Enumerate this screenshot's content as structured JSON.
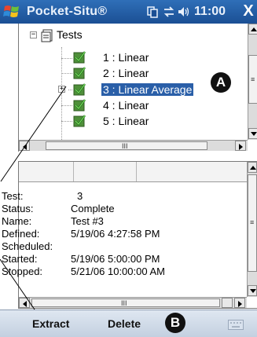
{
  "title_bar": {
    "app_title": "Pocket-Situ®",
    "clock": "11:00",
    "close_glyph": "X",
    "icons": [
      "windows-start-icon",
      "connectivity-icon",
      "sync-icon",
      "speaker-icon"
    ]
  },
  "tree": {
    "root": {
      "label": "Tests",
      "expander": "−"
    },
    "items": [
      {
        "label": "1 : Linear",
        "selected": false,
        "expander": ""
      },
      {
        "label": "2 : Linear",
        "selected": false,
        "expander": ""
      },
      {
        "label": "3 : Linear Average",
        "selected": true,
        "expander": "+"
      },
      {
        "label": "4 : Linear",
        "selected": false,
        "expander": ""
      },
      {
        "label": "5 : Linear",
        "selected": false,
        "expander": ""
      }
    ]
  },
  "details": {
    "rows": [
      {
        "label": "Test:",
        "value": "3"
      },
      {
        "label": "Status:",
        "value": "Complete"
      },
      {
        "label": "Name:",
        "value": "Test #3"
      },
      {
        "label": "Defined:",
        "value": "5/19/06 4:27:58 PM"
      },
      {
        "label": "Scheduled:",
        "value": ""
      },
      {
        "label": "Started:",
        "value": "5/19/06 5:00:00 PM"
      },
      {
        "label": "Stopped:",
        "value": "5/21/06 10:00:00 AM"
      }
    ]
  },
  "scrollbar": {
    "grip": "|||",
    "grip_horizontal": "III",
    "grip_vertical": "≡"
  },
  "menu_bar": {
    "left_label": "Extract",
    "right_label": "Delete"
  },
  "callouts": {
    "a": "A",
    "b": "B"
  },
  "colors": {
    "title_bar": "#1b4f94",
    "selection": "#2a5fa8",
    "menu_bar": "#c3d0e0"
  }
}
